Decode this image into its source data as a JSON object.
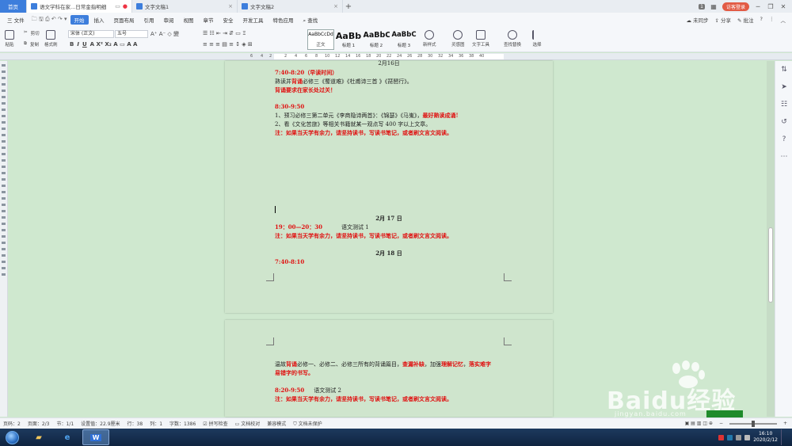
{
  "tabs": {
    "home": "首页",
    "tab1": "语文学科在家...日常金指明细",
    "tab2": "文字文稿1",
    "tab3": "文字文稿2",
    "new_tab": "+",
    "badge": "1",
    "login": "访客登录"
  },
  "menu": {
    "file": "三 文件",
    "items": [
      "开始",
      "插入",
      "页面布局",
      "引用",
      "审阅",
      "视图",
      "章节",
      "安全",
      "开发工具",
      "特色应用"
    ],
    "search": "查找",
    "sync": "未同步",
    "share": "分享",
    "annotate": "批注"
  },
  "ribbon": {
    "paste": "粘贴",
    "cut": "剪切",
    "copy": "复制",
    "format_painter": "格式刷",
    "font_name": "宋体 (正文)",
    "font_size": "五号",
    "styles": [
      {
        "preview": "AaBbCcDd",
        "name": "正文"
      },
      {
        "preview": "AaBb",
        "name": "标题 1"
      },
      {
        "preview": "AaBbC",
        "name": "标题 2"
      },
      {
        "preview": "AaBbC",
        "name": "标题 3"
      }
    ],
    "new_style": "新样式",
    "inspiration": "灵感图",
    "text_tools": "文字工具",
    "find_replace": "查找替换",
    "select": "选择"
  },
  "ruler": [
    "6",
    "4",
    "2",
    "2",
    "4",
    "6",
    "8",
    "10",
    "12",
    "14",
    "16",
    "18",
    "20",
    "22",
    "24",
    "26",
    "28",
    "30",
    "32",
    "34",
    "36",
    "38",
    "40"
  ],
  "document": {
    "page1_header_partial": "2月16日",
    "p1_time1": "7:40-8:20（早读时间）",
    "p1_line1_pre": "熟读并",
    "p1_line1_red": "背诵",
    "p1_line1_post": "必修三《蜀道难》《杜甫诗三首 》《琵琶行》。",
    "p1_line2": "背诵要求在家长处过关！",
    "p1_time2": "8:30-9:50",
    "p1_line3_pre": "1、预习必修三第二单元《李商隐诗两首》：《锦瑟》《马嵬》，",
    "p1_line3_red": "最好熟读成诵!",
    "p1_line4": "2、看《文化苦旅》等相关书籍就某一观点写 400 字以上文章。",
    "p1_note1": "注：如果当天学有余力，请坚持读书，写读书笔记，或者刷文言文阅读。",
    "date17": "2月 17 日",
    "time17": "19：00—20：30",
    "test1": "语文测试 1",
    "note17": "注：如果当天学有余力，请坚持读书，写读书笔记，或者刷文言文阅读。",
    "date18": "2月 18 日",
    "time18": "7:40-8:10",
    "p2_line1_pre": "温故",
    "p2_line1_red1": "背诵",
    "p2_line1_mid": "必修一、必修二、必修三所有的背诵篇目，",
    "p2_line1_red2": "查漏补缺",
    "p2_line1_mid2": "，加强",
    "p2_line1_red3": "理解记忆",
    "p2_line1_end": "，",
    "p2_line1_red4": "落实难字",
    "p2_line2": "易错字的书写。",
    "p2_time": "8:20-9:50",
    "p2_test": "语文测试 2",
    "p2_note": "注：如果当天学有余力，请坚持读书，写读书笔记，或者刷文言文阅读。"
  },
  "status": {
    "page": "页码：2",
    "pages": "页面：2/3",
    "section": "节：1/1",
    "setting": "设置值：22.9厘米",
    "row": "行：38",
    "col": "列：1",
    "words": "字数：1386",
    "spell": "拼写检查",
    "proof": "文档校对",
    "compat": "兼容模式",
    "protect": "文档未保护",
    "zoom_minus": "−",
    "zoom_plus": "+"
  },
  "taskbar": {
    "time": "16:10",
    "date": "2020/2/12",
    "app_label": "W"
  },
  "watermark": {
    "brand": "Baidu经验",
    "url": "jingyan.baidu.com"
  },
  "colors": {
    "accent": "#3d7edc",
    "page_bg": "#cfe5cd",
    "red_text": "#e01010"
  }
}
